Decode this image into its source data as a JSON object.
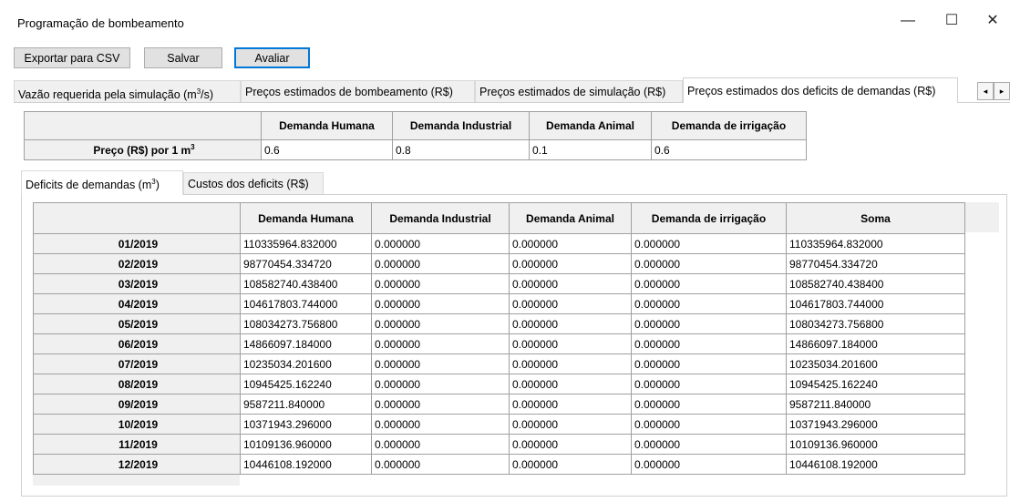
{
  "window": {
    "title": "Programação de bombeamento",
    "minimize": "—",
    "maximize": "☐",
    "close": "✕"
  },
  "toolbar": {
    "export_label": "Exportar para CSV",
    "save_label": "Salvar",
    "evaluate_label": "Avaliar"
  },
  "tabs": [
    {
      "label_pre": "Vazão requerida pela simulação (m",
      "sup": "3",
      "label_post": "/s)"
    },
    {
      "label": "Preços estimados de bombeamento (R$)"
    },
    {
      "label": "Preços estimados de simulação (R$)"
    },
    {
      "label": "Preços estimados dos deficits de demandas (R$)"
    }
  ],
  "tab_scroll": {
    "left": "◂",
    "right": "▸"
  },
  "price_table": {
    "headers": [
      "Demanda Humana",
      "Demanda Industrial",
      "Demanda Animal",
      "Demanda de irrigação"
    ],
    "row_label_pre": "Preço (R$) por 1 m",
    "row_label_sup": "3",
    "values": [
      "0.6",
      "0.8",
      "0.1",
      "0.6"
    ]
  },
  "subtabs": [
    {
      "label_pre": "Deficits de demandas (m",
      "sup": "3",
      "label_post": ")"
    },
    {
      "label": "Custos dos deficits (R$)"
    }
  ],
  "deficit_table": {
    "headers": [
      "Demanda Humana",
      "Demanda Industrial",
      "Demanda Animal",
      "Demanda de irrigação",
      "Soma"
    ],
    "rows": [
      {
        "month": "01/2019",
        "values": [
          "110335964.832000",
          "0.000000",
          "0.000000",
          "0.000000",
          "110335964.832000"
        ]
      },
      {
        "month": "02/2019",
        "values": [
          "98770454.334720",
          "0.000000",
          "0.000000",
          "0.000000",
          "98770454.334720"
        ]
      },
      {
        "month": "03/2019",
        "values": [
          "108582740.438400",
          "0.000000",
          "0.000000",
          "0.000000",
          "108582740.438400"
        ]
      },
      {
        "month": "04/2019",
        "values": [
          "104617803.744000",
          "0.000000",
          "0.000000",
          "0.000000",
          "104617803.744000"
        ]
      },
      {
        "month": "05/2019",
        "values": [
          "108034273.756800",
          "0.000000",
          "0.000000",
          "0.000000",
          "108034273.756800"
        ]
      },
      {
        "month": "06/2019",
        "values": [
          "14866097.184000",
          "0.000000",
          "0.000000",
          "0.000000",
          "14866097.184000"
        ]
      },
      {
        "month": "07/2019",
        "values": [
          "10235034.201600",
          "0.000000",
          "0.000000",
          "0.000000",
          "10235034.201600"
        ]
      },
      {
        "month": "08/2019",
        "values": [
          "10945425.162240",
          "0.000000",
          "0.000000",
          "0.000000",
          "10945425.162240"
        ]
      },
      {
        "month": "09/2019",
        "values": [
          "9587211.840000",
          "0.000000",
          "0.000000",
          "0.000000",
          "9587211.840000"
        ]
      },
      {
        "month": "10/2019",
        "values": [
          "10371943.296000",
          "0.000000",
          "0.000000",
          "0.000000",
          "10371943.296000"
        ]
      },
      {
        "month": "11/2019",
        "values": [
          "10109136.960000",
          "0.000000",
          "0.000000",
          "0.000000",
          "10109136.960000"
        ]
      },
      {
        "month": "12/2019",
        "values": [
          "10446108.192000",
          "0.000000",
          "0.000000",
          "0.000000",
          "10446108.192000"
        ]
      }
    ]
  }
}
